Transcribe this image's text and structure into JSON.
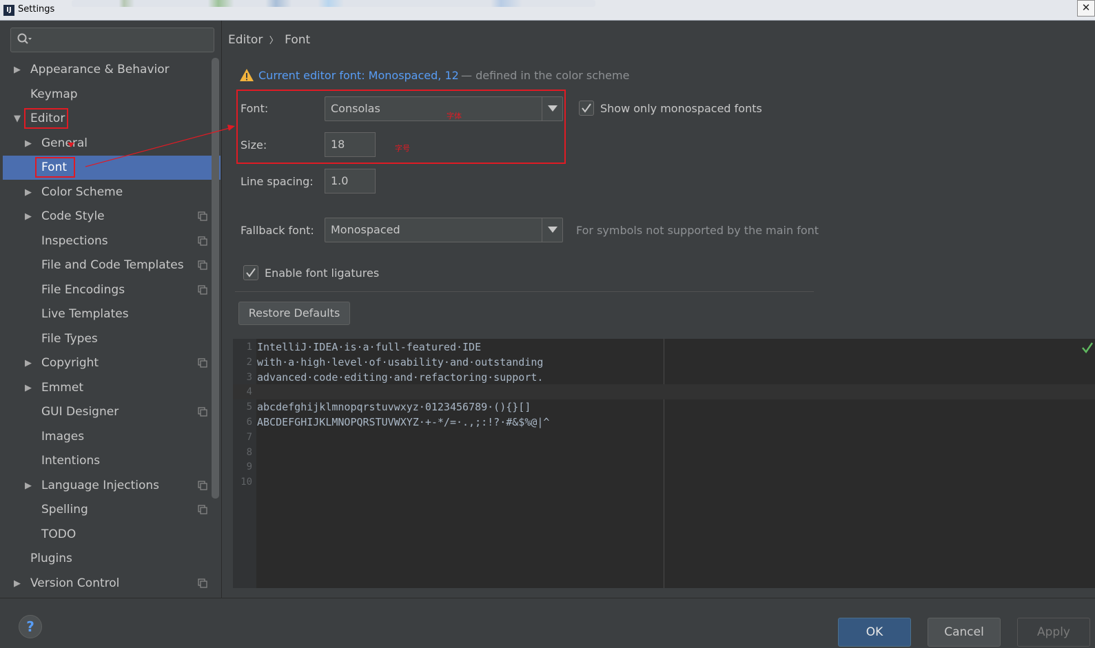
{
  "window": {
    "title": "Settings",
    "close_glyph": "✕",
    "app_icon": "IJ"
  },
  "search": {
    "placeholder": "",
    "icon": "search-icon"
  },
  "sidebar": {
    "items": [
      {
        "label": "Appearance & Behavior",
        "expandable": true,
        "expanded": false,
        "level": 0,
        "copy_icon": false
      },
      {
        "label": "Keymap",
        "expandable": false,
        "level": 0,
        "copy_icon": false
      },
      {
        "label": "Editor",
        "expandable": true,
        "expanded": true,
        "level": 0,
        "copy_icon": false
      },
      {
        "label": "General",
        "expandable": true,
        "expanded": false,
        "level": 1,
        "copy_icon": false
      },
      {
        "label": "Font",
        "expandable": false,
        "level": 1,
        "selected": true,
        "copy_icon": false
      },
      {
        "label": "Color Scheme",
        "expandable": true,
        "expanded": false,
        "level": 1,
        "copy_icon": false
      },
      {
        "label": "Code Style",
        "expandable": true,
        "expanded": false,
        "level": 1,
        "copy_icon": true
      },
      {
        "label": "Inspections",
        "expandable": false,
        "level": 1,
        "copy_icon": true
      },
      {
        "label": "File and Code Templates",
        "expandable": false,
        "level": 1,
        "copy_icon": true
      },
      {
        "label": "File Encodings",
        "expandable": false,
        "level": 1,
        "copy_icon": true
      },
      {
        "label": "Live Templates",
        "expandable": false,
        "level": 1,
        "copy_icon": false
      },
      {
        "label": "File Types",
        "expandable": false,
        "level": 1,
        "copy_icon": false
      },
      {
        "label": "Copyright",
        "expandable": true,
        "expanded": false,
        "level": 1,
        "copy_icon": true
      },
      {
        "label": "Emmet",
        "expandable": true,
        "expanded": false,
        "level": 1,
        "copy_icon": false
      },
      {
        "label": "GUI Designer",
        "expandable": false,
        "level": 1,
        "copy_icon": true
      },
      {
        "label": "Images",
        "expandable": false,
        "level": 1,
        "copy_icon": false
      },
      {
        "label": "Intentions",
        "expandable": false,
        "level": 1,
        "copy_icon": false
      },
      {
        "label": "Language Injections",
        "expandable": true,
        "expanded": false,
        "level": 1,
        "copy_icon": true
      },
      {
        "label": "Spelling",
        "expandable": false,
        "level": 1,
        "copy_icon": true
      },
      {
        "label": "TODO",
        "expandable": false,
        "level": 1,
        "copy_icon": false
      },
      {
        "label": "Plugins",
        "expandable": false,
        "level": 0,
        "copy_icon": false
      },
      {
        "label": "Version Control",
        "expandable": true,
        "expanded": false,
        "level": 0,
        "copy_icon": true
      }
    ]
  },
  "breadcrumb": {
    "parent": "Editor",
    "separator": "〉",
    "current": "Font"
  },
  "warning": {
    "link": "Current editor font: Monospaced, 12",
    "rest": " — defined in the color scheme"
  },
  "font": {
    "label": "Font:",
    "value": "Consolas",
    "annotation": "字体"
  },
  "show_mono": {
    "label": "Show only monospaced fonts",
    "checked": true
  },
  "size": {
    "label": "Size:",
    "value": "18",
    "annotation": "字号"
  },
  "line_spacing": {
    "label": "Line spacing:",
    "value": "1.0"
  },
  "fallback": {
    "label": "Fallback font:",
    "value": "Monospaced",
    "hint": "For symbols not supported by the main font"
  },
  "ligatures": {
    "label": "Enable font ligatures",
    "checked": true
  },
  "restore_defaults": "Restore Defaults",
  "preview": {
    "lines": [
      {
        "n": "1",
        "text": "IntelliJ·IDEA·is·a·full-featured·IDE"
      },
      {
        "n": "2",
        "text": "with·a·high·level·of·usability·and·outstanding"
      },
      {
        "n": "3",
        "text": "advanced·code·editing·and·refactoring·support."
      },
      {
        "n": "4",
        "text": ""
      },
      {
        "n": "5",
        "text": "abcdefghijklmnopqrstuvwxyz·0123456789·(){}[]"
      },
      {
        "n": "6",
        "text": "ABCDEFGHIJKLMNOPQRSTUVWXYZ·+-*/=·.,;:!?·#&$%@|^"
      },
      {
        "n": "7",
        "text": ""
      },
      {
        "n": "8",
        "text": ""
      },
      {
        "n": "9",
        "text": ""
      },
      {
        "n": "10",
        "text": ""
      }
    ]
  },
  "buttons": {
    "help": "?",
    "ok": "OK",
    "cancel": "Cancel",
    "apply": "Apply"
  },
  "colors": {
    "accent": "#4b6eaf",
    "link": "#589df6",
    "annotation": "#e01b24",
    "background": "#3c3f41",
    "editor_bg": "#2b2b2b"
  }
}
